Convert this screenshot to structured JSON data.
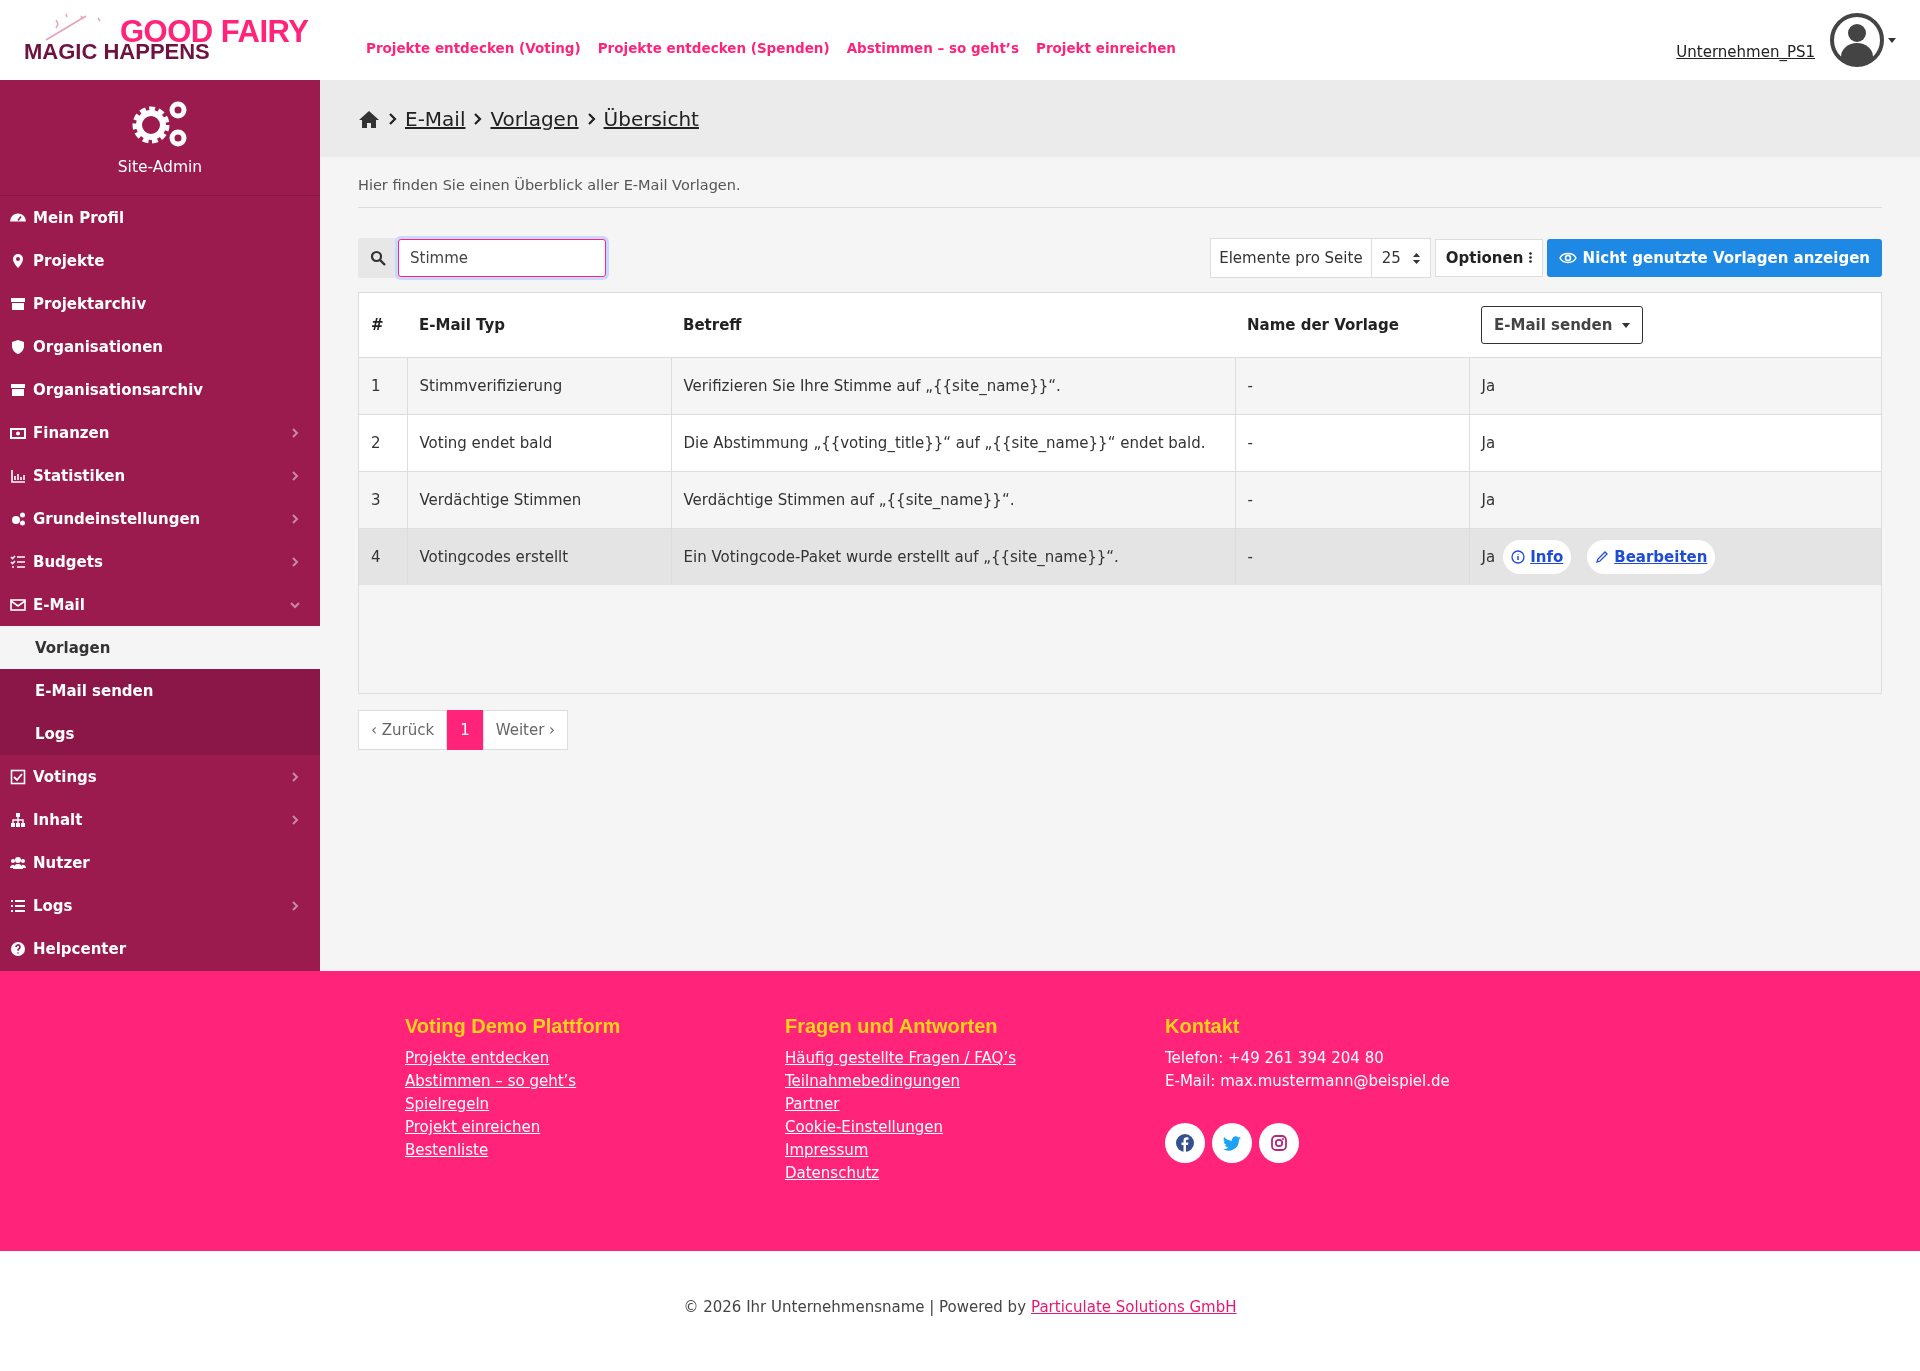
{
  "header": {
    "logo": {
      "top": "GOOD FAIRY",
      "bottom": "MAGIC HAPPENS"
    },
    "nav": [
      "Projekte entdecken (Voting)",
      "Projekte entdecken (Spenden)",
      "Abstimmen – so geht’s",
      "Projekt einreichen"
    ],
    "user": "Unternehmen_PS1"
  },
  "sidebar": {
    "title": "Site-Admin",
    "items": [
      {
        "label": "Mein Profil"
      },
      {
        "label": "Projekte"
      },
      {
        "label": "Projektarchiv"
      },
      {
        "label": "Organisationen"
      },
      {
        "label": "Organisationsarchiv"
      },
      {
        "label": "Finanzen",
        "expanded": false
      },
      {
        "label": "Statistiken",
        "expanded": false
      },
      {
        "label": "Grundeinstellungen",
        "expanded": false
      },
      {
        "label": "Budgets",
        "expanded": false
      },
      {
        "label": "E-Mail",
        "expanded": true,
        "children": [
          {
            "label": "Vorlagen",
            "selected": true
          },
          {
            "label": "E-Mail senden",
            "selected": false
          },
          {
            "label": "Logs",
            "selected": false
          }
        ]
      },
      {
        "label": "Votings",
        "expanded": false
      },
      {
        "label": "Inhalt",
        "expanded": false
      },
      {
        "label": "Nutzer"
      },
      {
        "label": "Logs",
        "expanded": false
      },
      {
        "label": "Helpcenter"
      }
    ]
  },
  "breadcrumb": [
    "E-Mail",
    "Vorlagen",
    "Übersicht"
  ],
  "intro": "Hier finden Sie einen Überblick aller E-Mail Vorlagen.",
  "toolbar": {
    "search": "Stimme",
    "per_page_label": "Elemente pro Seite",
    "per_page": "25",
    "options": "Optionen",
    "show_unused": "Nicht genutzte Vorlagen anzeigen"
  },
  "table": {
    "columns": [
      "#",
      "E-Mail Typ",
      "Betreff",
      "Name der Vorlage"
    ],
    "filter": "E-Mail senden",
    "rows": [
      {
        "cells": [
          "1",
          "Stimmverifizierung",
          "Verifizieren Sie Ihre Stimme auf „{{site_name}}“.",
          "-",
          "Ja"
        ],
        "highlighted": false
      },
      {
        "cells": [
          "2",
          "Voting endet bald",
          "Die Abstimmung „{{voting_title}}“ auf „{{site_name}}“ endet bald.",
          "-",
          "Ja"
        ],
        "highlighted": false
      },
      {
        "cells": [
          "3",
          "Verdächtige Stimmen",
          "Verdächtige Stimmen auf „{{site_name}}“.",
          "-",
          "Ja"
        ],
        "highlighted": false
      },
      {
        "cells": [
          "4",
          "Votingcodes erstellt",
          "Ein Votingcode-Paket wurde erstellt auf „{{site_name}}“.",
          "-",
          "Ja"
        ],
        "highlighted": true,
        "actions": [
          {
            "kind": "info",
            "label": "Info"
          },
          {
            "kind": "edit",
            "label": "Bearbeiten"
          }
        ]
      }
    ]
  },
  "pagination": [
    {
      "label": "‹ Zurück",
      "selected": false
    },
    {
      "label": "1",
      "selected": true
    },
    {
      "label": "Weiter ›",
      "selected": false
    }
  ],
  "footer": {
    "columns": [
      {
        "title": "Voting Demo Plattform",
        "links": [
          "Projekte entdecken",
          "Abstimmen – so geht’s",
          "Spielregeln",
          "Projekt einreichen",
          "Bestenliste"
        ]
      },
      {
        "title": "Fragen und Antworten",
        "links": [
          "Häufig gestellte Fragen / FAQ’s",
          "Teilnahmebedingungen",
          "Partner",
          "Cookie-Einstellungen",
          "Impressum",
          "Datenschutz"
        ]
      },
      {
        "title": "Kontakt",
        "lines": [
          "Telefon: +49 261 394 204 80",
          "E-Mail: max.mustermann@beispiel.de"
        ]
      }
    ],
    "copyright": "© 2026 Ihr Unternehmensname | Powered by",
    "company": "Particulate Solutions GmbH"
  }
}
